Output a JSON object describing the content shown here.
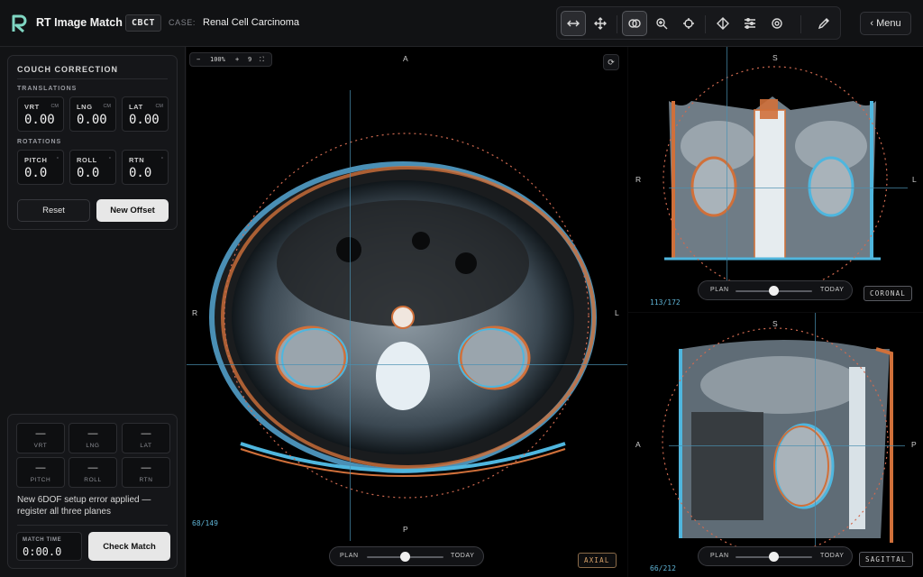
{
  "header": {
    "app_title": "RT Image Match",
    "modality": "CBCT",
    "case_label": "CASE:",
    "case_name": "Renal Cell Carcinoma",
    "menu_label": "‹ Menu",
    "tools": [
      "swap-icon",
      "move-icon",
      "overlay-icon",
      "zoom-icon",
      "crosshair-icon",
      "contrast-icon",
      "sliders-icon",
      "target-icon",
      "pencil-icon"
    ]
  },
  "couch": {
    "title": "COUCH CORRECTION",
    "translations_label": "TRANSLATIONS",
    "rotations_label": "ROTATIONS",
    "translations": [
      {
        "name": "VRT",
        "unit": "CM",
        "value": "0.00"
      },
      {
        "name": "LNG",
        "unit": "CM",
        "value": "0.00"
      },
      {
        "name": "LAT",
        "unit": "CM",
        "value": "0.00"
      }
    ],
    "rotations": [
      {
        "name": "PITCH",
        "unit": "°",
        "value": "0.0"
      },
      {
        "name": "ROLL",
        "unit": "°",
        "value": "0.0"
      },
      {
        "name": "RTN",
        "unit": "°",
        "value": "0.0"
      }
    ],
    "reset_label": "Reset",
    "new_offset_label": "New Offset"
  },
  "result": {
    "cells": [
      {
        "name": "VRT",
        "value": "—"
      },
      {
        "name": "LNG",
        "value": "—"
      },
      {
        "name": "LAT",
        "value": "—"
      },
      {
        "name": "PITCH",
        "value": "—"
      },
      {
        "name": "ROLL",
        "value": "—"
      },
      {
        "name": "RTN",
        "value": "—"
      }
    ],
    "status": "New 6DOF setup error applied — register all three planes",
    "match_time_label": "MATCH TIME",
    "match_time_value": "0:00.0",
    "check_label": "Check Match"
  },
  "axial": {
    "zoom": {
      "minus": "−",
      "level": "100%",
      "plus": "+",
      "extra": "9",
      "fit": "⛶"
    },
    "reset_icon": "⟳",
    "orient": {
      "top": "A",
      "bottom": "P",
      "left": "R",
      "right": "L"
    },
    "slice": "68/149",
    "badge": "AXIAL",
    "plan_label": "PLAN",
    "today_label": "TODAY",
    "blend": 0.5
  },
  "coronal": {
    "orient": {
      "top": "S",
      "left": "R",
      "right": "L"
    },
    "slice": "113/172",
    "badge": "CORONAL",
    "plan_label": "PLAN",
    "today_label": "TODAY",
    "blend": 0.5
  },
  "sagittal": {
    "orient": {
      "top": "S",
      "left": "A",
      "right": "P"
    },
    "slice": "66/212",
    "badge": "SAGITTAL",
    "plan_label": "PLAN",
    "today_label": "TODAY",
    "blend": 0.5
  },
  "colors": {
    "accent_orange": "#e0773a",
    "accent_cyan": "#4fb6de",
    "badge_orange": "#d9a36a"
  }
}
